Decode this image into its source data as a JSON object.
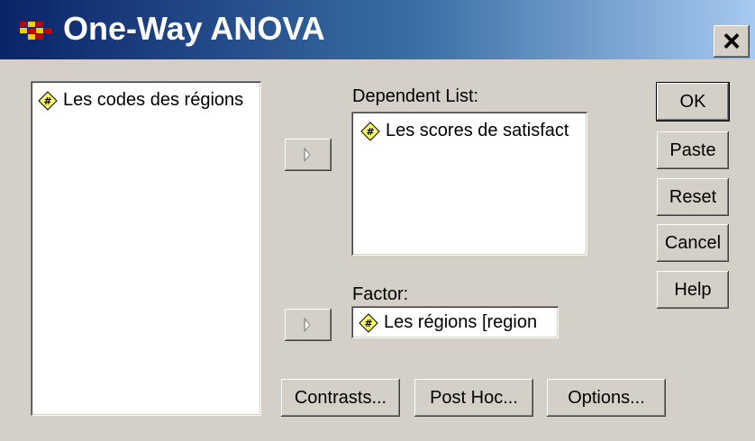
{
  "window": {
    "title": "One-Way ANOVA",
    "app_icon": "spss-grid-icon",
    "close_icon": "close-icon",
    "close_label": "×"
  },
  "source_list": {
    "items": [
      {
        "label": "Les codes des régions",
        "icon": "scale-variable-icon"
      }
    ]
  },
  "dependent_list": {
    "label": "Dependent List:",
    "items": [
      {
        "label": "Les scores de satisfact",
        "icon": "scale-variable-icon"
      }
    ]
  },
  "factor": {
    "label": "Factor:",
    "value": "Les régions [region",
    "icon": "scale-variable-icon"
  },
  "arrow_icon": "right-arrow-icon",
  "buttons": {
    "ok": "OK",
    "paste": "Paste",
    "reset": "Reset",
    "cancel": "Cancel",
    "help": "Help"
  },
  "bottom_buttons": {
    "contrasts": "Contrasts...",
    "post_hoc": "Post Hoc...",
    "options": "Options..."
  }
}
